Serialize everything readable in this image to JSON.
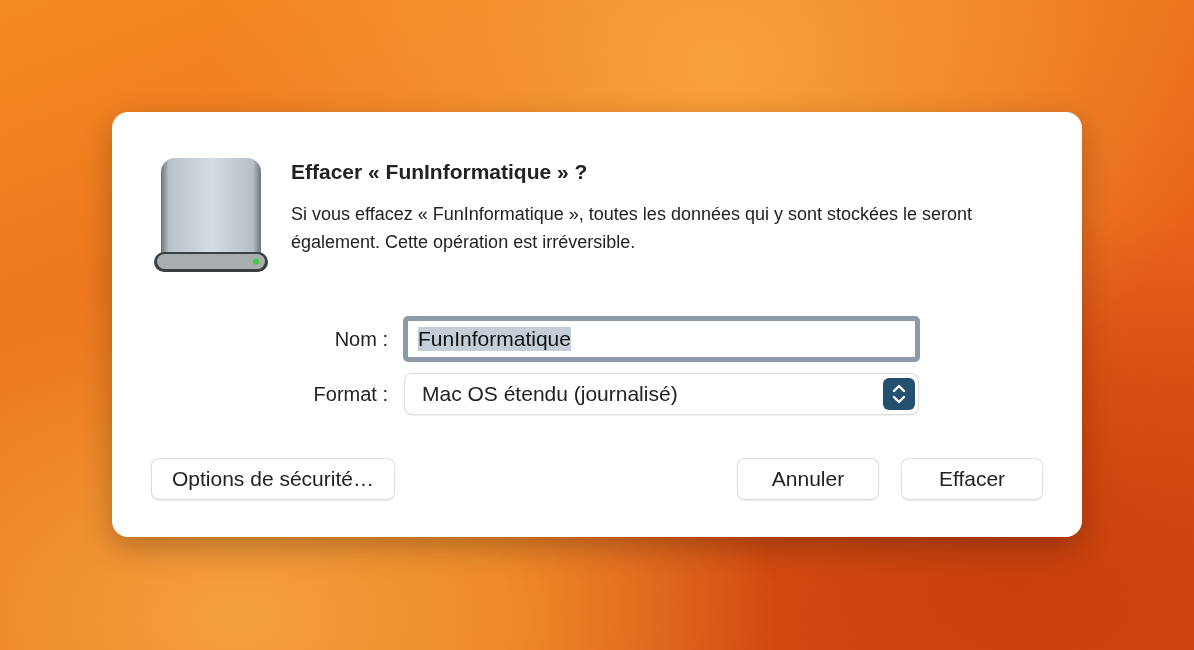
{
  "dialog": {
    "title": "Effacer « FunInformatique » ?",
    "message": "Si vous effacez « FunInformatique », toutes les données qui y sont stockées le seront également. Cette opération est irréversible.",
    "fields": [
      {
        "kind": "text",
        "label": "Nom :",
        "value": "FunInformatique",
        "focused": true,
        "value_selected": true
      },
      {
        "kind": "popup",
        "label": "Format :",
        "value": "Mac OS étendu (journalisé)"
      }
    ],
    "left_buttons": [
      "Options de sécurité…"
    ],
    "right_buttons": [
      "Annuler",
      "Effacer"
    ]
  }
}
